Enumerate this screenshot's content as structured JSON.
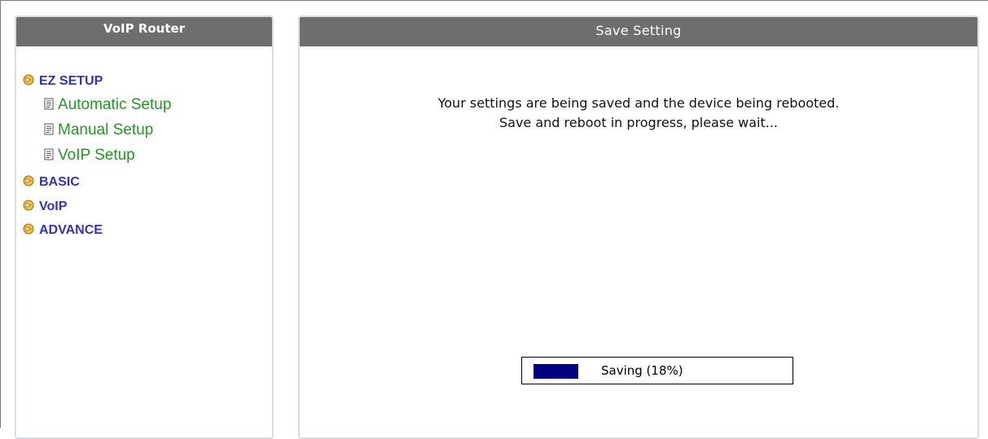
{
  "colors": {
    "header_bg": "#6e6e6e",
    "menu_category": "#3333bb",
    "menu_subitem": "#229922",
    "progress_fill": "#000080"
  },
  "sidebar": {
    "title": "VoIP Router",
    "categories": [
      {
        "label": "EZ SETUP",
        "icon": "arrow-bullet-icon",
        "items": [
          {
            "label": "Automatic Setup",
            "icon": "document-icon"
          },
          {
            "label": "Manual Setup",
            "icon": "document-icon"
          },
          {
            "label": "VoIP Setup",
            "icon": "document-icon"
          }
        ]
      },
      {
        "label": "BASIC",
        "icon": "arrow-bullet-icon"
      },
      {
        "label": "VoIP",
        "icon": "arrow-bullet-icon"
      },
      {
        "label": "ADVANCE",
        "icon": "arrow-bullet-icon"
      }
    ]
  },
  "main": {
    "title": "Save Setting",
    "message_line1": "Your settings are being saved and the device being rebooted.",
    "message_line2": "Save and reboot in progress, please wait...",
    "progress": {
      "label": "Saving (18%)",
      "percent": 18
    }
  }
}
